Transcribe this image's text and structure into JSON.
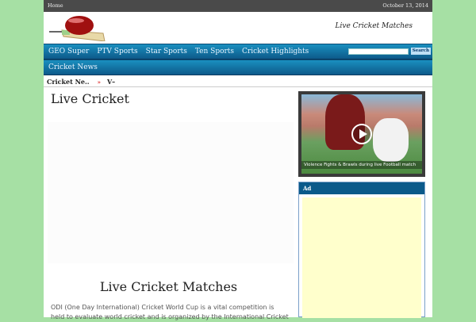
{
  "topbar": {
    "home": "Home",
    "date": "October 13, 2014"
  },
  "header": {
    "tagline": "Live Cricket Matches"
  },
  "nav": {
    "items": [
      "GEO Super",
      "PTV Sports",
      "Star Sports",
      "Ten Sports",
      "Cricket Highlights"
    ],
    "row2": [
      "Cricket News"
    ],
    "search_button": "Search",
    "search_value": ""
  },
  "ticker": {
    "label": "Cricket Ne..",
    "raquo": "»",
    "item": "V–"
  },
  "main": {
    "title": "Live Cricket",
    "subtitle": "Live Cricket Matches",
    "paragraph": "ODI (One Day International) Cricket World Cup is a vital competition is held to evaluate world cricket and is organized by the International Cricket"
  },
  "sidebar": {
    "video_caption": "Violence Fights & Brawls during live Football match",
    "ad_title": "Ad"
  }
}
